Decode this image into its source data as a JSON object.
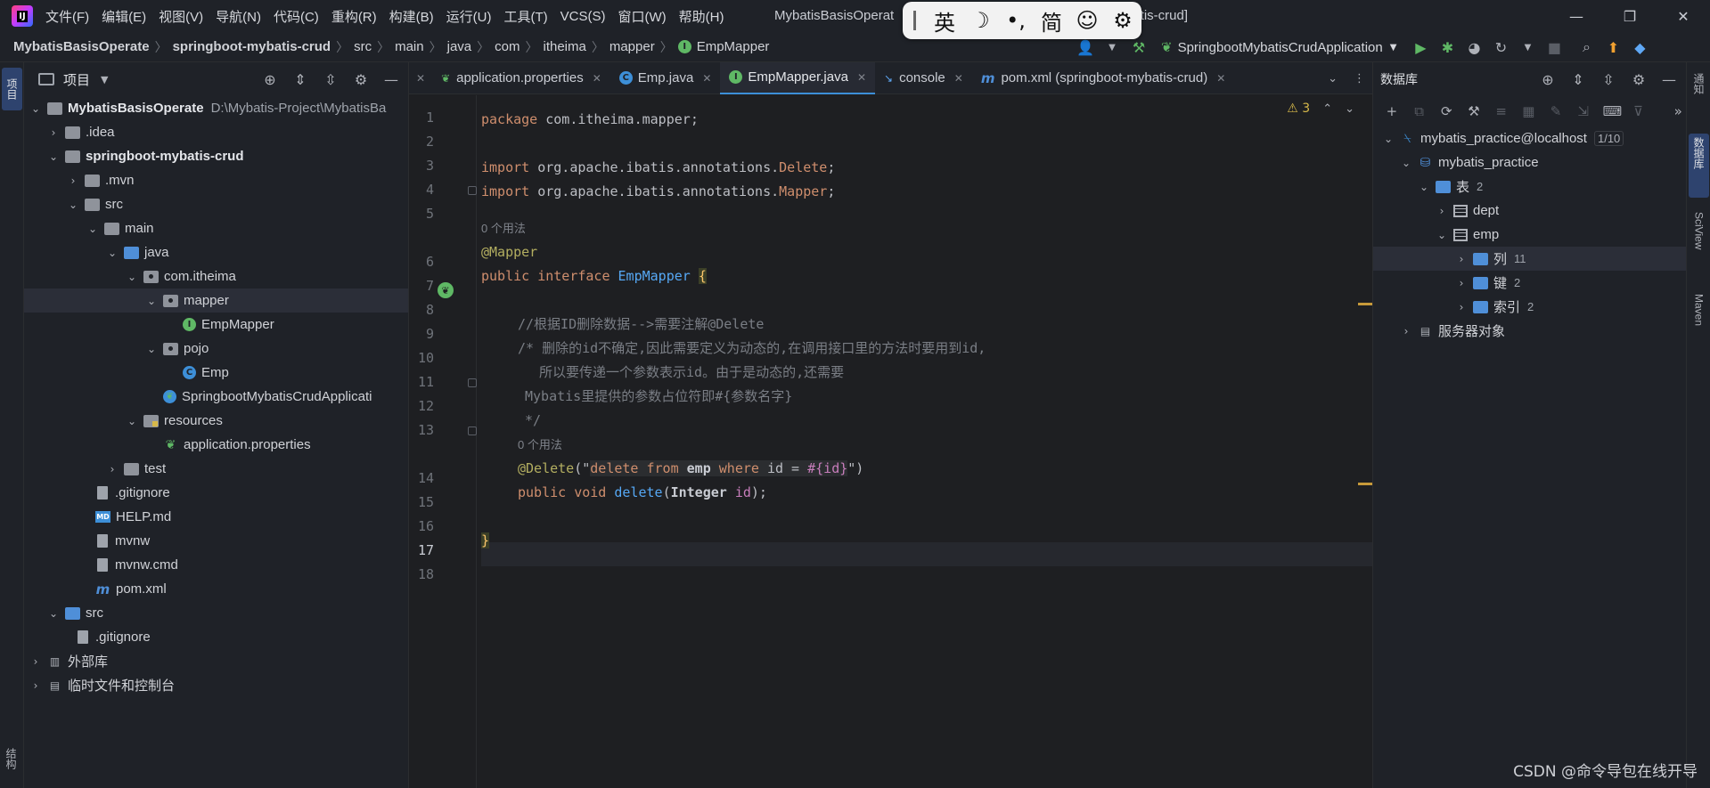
{
  "menubar": {
    "items": [
      "文件(F)",
      "编辑(E)",
      "视图(V)",
      "导航(N)",
      "代码(C)",
      "重构(R)",
      "构建(B)",
      "运行(U)",
      "工具(T)",
      "VCS(S)",
      "窗口(W)",
      "帮助(H)"
    ],
    "title_visible": "MybatisBasisOperat",
    "title_tail": "batis-crud]",
    "window_controls": [
      "—",
      "❐",
      "✕"
    ]
  },
  "ime": {
    "items": [
      "英",
      "☽",
      "•,",
      "简",
      "☺",
      "⚙"
    ]
  },
  "breadcrumb": {
    "items": [
      "MybatisBasisOperate",
      "springboot-mybatis-crud",
      "src",
      "main",
      "java",
      "com",
      "itheima",
      "mapper",
      "EmpMapper"
    ]
  },
  "run": {
    "config_name": "SpringbootMybatisCrudApplication"
  },
  "left_strip": {
    "project_tab": "项目",
    "structure_tab": "结构"
  },
  "project": {
    "title": "项目",
    "tree": [
      {
        "label": "MybatisBasisOperate",
        "path": "D:\\Mybatis-Project\\MybatisBa"
      },
      {
        "label": ".idea"
      },
      {
        "label": "springboot-mybatis-crud"
      },
      {
        "label": ".mvn"
      },
      {
        "label": "src"
      },
      {
        "label": "main"
      },
      {
        "label": "java"
      },
      {
        "label": "com.itheima"
      },
      {
        "label": "mapper"
      },
      {
        "label": "EmpMapper"
      },
      {
        "label": "pojo"
      },
      {
        "label": "Emp"
      },
      {
        "label": "SpringbootMybatisCrudApplicati"
      },
      {
        "label": "resources"
      },
      {
        "label": "application.properties"
      },
      {
        "label": "test"
      },
      {
        "label": ".gitignore"
      },
      {
        "label": "HELP.md"
      },
      {
        "label": "mvnw"
      },
      {
        "label": "mvnw.cmd"
      },
      {
        "label": "pom.xml"
      },
      {
        "label": "src"
      },
      {
        "label": ".gitignore"
      },
      {
        "label": "外部库"
      },
      {
        "label": "临时文件和控制台"
      }
    ]
  },
  "editor": {
    "tabs": [
      {
        "label": "application.properties",
        "icon": "spring-leaf-icon"
      },
      {
        "label": "Emp.java",
        "icon": "class-icon"
      },
      {
        "label": "EmpMapper.java",
        "icon": "interface-icon",
        "active": true
      },
      {
        "label": "console",
        "icon": "console-icon"
      },
      {
        "label": "pom.xml (springboot-mybatis-crud)",
        "icon": "maven-icon"
      }
    ],
    "warnings_count": "3",
    "line_numbers": [
      "1",
      "2",
      "3",
      "4",
      "5",
      "6",
      "7",
      "8",
      "9",
      "10",
      "11",
      "12",
      "13",
      "14",
      "15",
      "16",
      "17",
      "18"
    ],
    "current_line": "17",
    "code": {
      "l1_kw": "package",
      "l1_pkg": "com.itheima.mapper",
      "l1_end": ";",
      "l3_kw": "import",
      "l3_pkg": "org.apache.ibatis.annotations.",
      "l3_cls": "Delete",
      "l3_end": ";",
      "l4_kw": "import",
      "l4_pkg": "org.apache.ibatis.annotations.",
      "l4_cls": "Mapper",
      "l4_end": ";",
      "usages_hint_1": "0 个用法",
      "l6": "@Mapper",
      "l7_kw1": "public",
      "l7_kw2": "interface",
      "l7_name": "EmpMapper",
      "l7_brace": "{",
      "l9": "//根据ID删除数据-->需要注解@Delete",
      "l10": "/* 删除的id不确定,因此需要定义为动态的,在调用接口里的方法时要用到id,",
      "l11": "所以要传递一个参数表示id。由于是动态的,还需要",
      "l12": "Mybatis里提供的参数占位符即#{参数名字}",
      "l13": "*/",
      "usages_hint_2": "0 个用法",
      "l14_ann": "@Delete",
      "l14_open": "(\"",
      "l14_sql_kw1": "delete from ",
      "l14_sql_tbl": "emp",
      "l14_sql_kw2": " where ",
      "l14_sql_col": "id = ",
      "l14_sql_param": "#{id}",
      "l14_close": "\")",
      "l15_kw1": "public",
      "l15_kw2": "void",
      "l15_meth": "delete",
      "l15_open": "(",
      "l15_type": "Integer",
      "l15_param": " id",
      "l15_close": ");",
      "l17": "}"
    }
  },
  "database": {
    "title": "数据库",
    "tree": [
      {
        "label": "mybatis_practice@localhost",
        "badge": "1/10"
      },
      {
        "label": "mybatis_practice"
      },
      {
        "label": "表",
        "count": "2"
      },
      {
        "label": "dept"
      },
      {
        "label": "emp"
      },
      {
        "label": "列",
        "count": "11"
      },
      {
        "label": "键",
        "count": "2"
      },
      {
        "label": "索引",
        "count": "2"
      },
      {
        "label": "服务器对象"
      }
    ]
  },
  "right_strip": {
    "tabs": [
      "通知",
      "数据库",
      "SciView",
      "Maven"
    ]
  },
  "watermark": "CSDN @命令导包在线开导"
}
